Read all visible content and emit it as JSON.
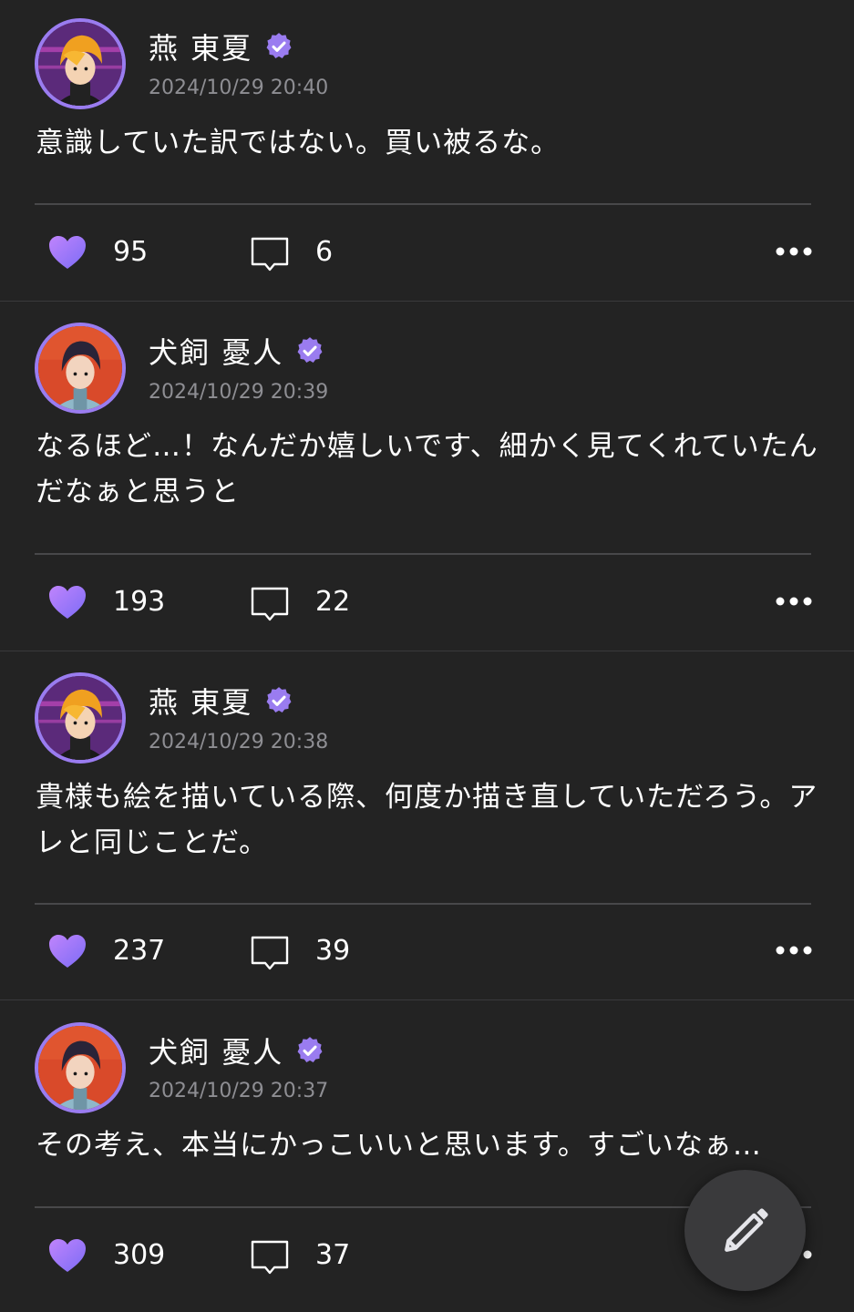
{
  "posts": [
    {
      "author": "燕 東夏",
      "avatar": "tsubame-avatar",
      "verified": true,
      "timestamp": "2024/10/29 20:40",
      "text": "意識していた訳ではない。買い被るな。",
      "likes": "95",
      "comments": "6"
    },
    {
      "author": "犬飼 憂人",
      "avatar": "inukai-avatar",
      "verified": true,
      "timestamp": "2024/10/29 20:39",
      "text": "なるほど…！なんだか嬉しいです、細かく見てくれていたんだなぁと思うと",
      "likes": "193",
      "comments": "22"
    },
    {
      "author": "燕 東夏",
      "avatar": "tsubame-avatar",
      "verified": true,
      "timestamp": "2024/10/29 20:38",
      "text": "貴様も絵を描いている際、何度か描き直していただろう。アレと同じことだ。",
      "likes": "237",
      "comments": "39"
    },
    {
      "author": "犬飼 憂人",
      "avatar": "inukai-avatar",
      "verified": true,
      "timestamp": "2024/10/29 20:37",
      "text": "その考え、本当にかっこいいと思います。すごいなぁ…",
      "likes": "309",
      "comments": "37"
    }
  ],
  "icons": {
    "like": "heart-icon",
    "comment": "comment-bubble-icon",
    "more": "more-dots-icon",
    "compose": "pencil-icon",
    "verified": "verified-badge-icon"
  },
  "colors": {
    "background": "#232323",
    "accent": "#9a7cf0",
    "heart_gradient": [
      "#c084fc",
      "#7c6cf6"
    ],
    "secondary_text": "#8e8e93"
  }
}
